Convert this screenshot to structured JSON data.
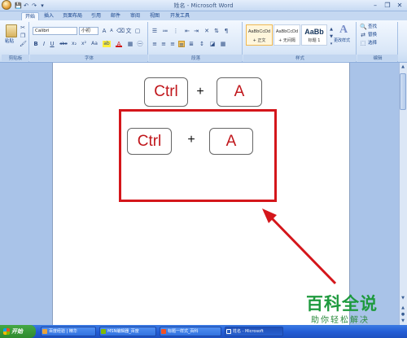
{
  "window": {
    "title": "姓名 - Microsoft Word",
    "minimize": "–",
    "restore": "❐",
    "close": "✕"
  },
  "qat": [
    "💾",
    "↶",
    "↷",
    "▾"
  ],
  "tabs": [
    "开始",
    "插入",
    "页面布局",
    "引用",
    "邮件",
    "审阅",
    "视图",
    "开发工具"
  ],
  "ribbon": {
    "clipboard": {
      "label": "剪贴板",
      "paste": "粘贴"
    },
    "font": {
      "label": "字体",
      "family": "Calibri",
      "size": "小初",
      "bold": "B",
      "italic": "I",
      "underline": "U",
      "strike": "abe",
      "sub": "x₂",
      "sup": "x²",
      "case": "Aa",
      "highlight": "ab",
      "color": "A",
      "grow": "A",
      "shrink": "A"
    },
    "paragraph": {
      "label": "段落"
    },
    "styles": {
      "label": "样式",
      "items": [
        {
          "sample": "AaBbCcDd",
          "name": "+ 正文"
        },
        {
          "sample": "AaBbCcDd",
          "name": "+ 无间隔"
        },
        {
          "sample": "AaBb",
          "name": "标题 1"
        }
      ],
      "change": "更改样式"
    },
    "editing": {
      "label": "编辑",
      "find": "查找",
      "replace": "替换",
      "select": "选择"
    }
  },
  "document": {
    "top_row": {
      "key1": "Ctrl",
      "plus": "+",
      "key2": "A"
    },
    "boxed_row": {
      "key1": "Ctrl",
      "plus": "+",
      "key2": "A"
    }
  },
  "watermark": {
    "title": "百科全说",
    "subtitle": "助你轻松解决"
  },
  "taskbar": {
    "start": "开始",
    "tasks": [
      "百度经验 | 精华",
      "MSN编辑器_百度",
      "标题一样式_百科",
      "姓名 - Microsoft"
    ]
  },
  "colors": {
    "accent_red": "#d4161b",
    "key_text": "#c0161b",
    "watermark": "#1e9a3e"
  }
}
